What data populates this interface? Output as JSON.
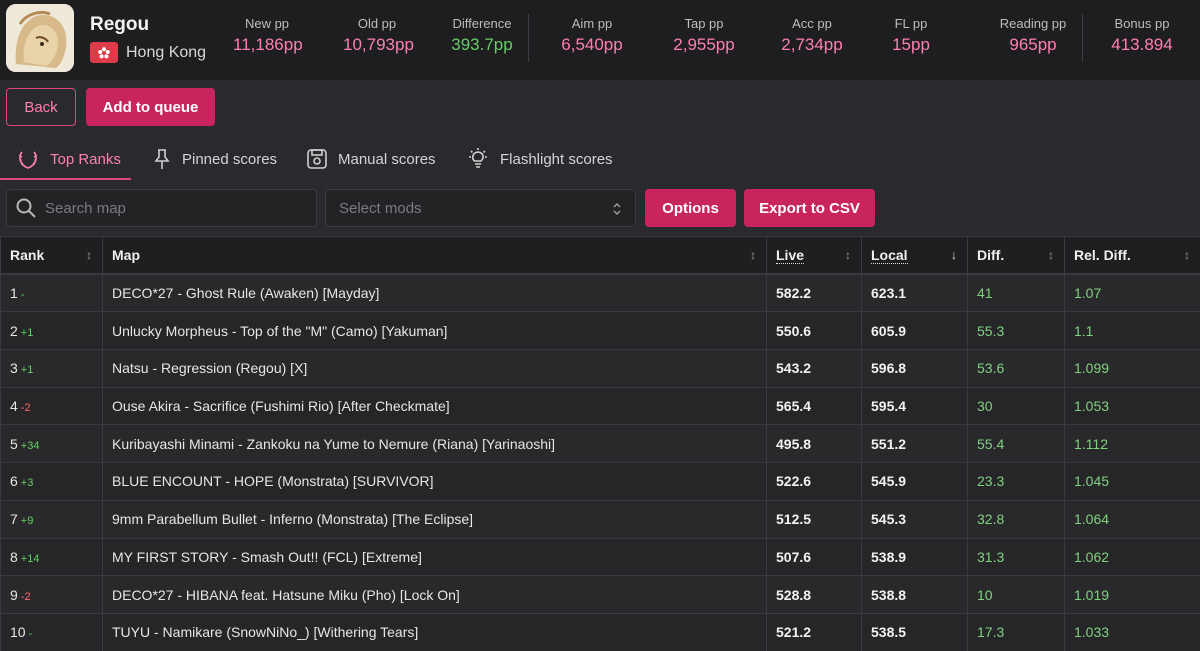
{
  "user": {
    "name": "Regou",
    "country": "Hong Kong"
  },
  "stats": [
    {
      "label": "New pp",
      "value": "11,186pp"
    },
    {
      "label": "Old pp",
      "value": "10,793pp"
    },
    {
      "label": "Difference",
      "value": "393.7pp"
    },
    {
      "label": "Aim pp",
      "value": "6,540pp"
    },
    {
      "label": "Tap pp",
      "value": "2,955pp"
    },
    {
      "label": "Acc pp",
      "value": "2,734pp"
    },
    {
      "label": "FL pp",
      "value": "15pp"
    },
    {
      "label": "Reading pp",
      "value": "965pp"
    },
    {
      "label": "Bonus pp",
      "value": "413.894"
    }
  ],
  "actions": {
    "back": "Back",
    "queue": "Add to queue"
  },
  "tabs": [
    {
      "label": "Top Ranks",
      "icon": "laurel-icon"
    },
    {
      "label": "Pinned scores",
      "icon": "pin-icon"
    },
    {
      "label": "Manual scores",
      "icon": "save-icon"
    },
    {
      "label": "Flashlight scores",
      "icon": "lightbulb-icon"
    }
  ],
  "filters": {
    "search_placeholder": "Search map",
    "mods_placeholder": "Select mods",
    "options": "Options",
    "export": "Export to CSV"
  },
  "columns": [
    "Rank",
    "Map",
    "Live",
    "Local",
    "Diff.",
    "Rel. Diff."
  ],
  "rows": [
    {
      "rank": "1",
      "change": "-",
      "map": "DECO*27 - Ghost Rule (Awaken) [Mayday]",
      "live": "582.2",
      "local": "623.1",
      "diff": "41",
      "rel": "1.07"
    },
    {
      "rank": "2",
      "change": "+1",
      "map": "Unlucky Morpheus - Top of the \"M\" (Camo) [Yakuman]",
      "live": "550.6",
      "local": "605.9",
      "diff": "55.3",
      "rel": "1.1"
    },
    {
      "rank": "3",
      "change": "+1",
      "map": "Natsu - Regression (Regou) [X]",
      "live": "543.2",
      "local": "596.8",
      "diff": "53.6",
      "rel": "1.099"
    },
    {
      "rank": "4",
      "change": "-2",
      "map": "Ouse Akira - Sacrifice (Fushimi Rio) [After Checkmate]",
      "live": "565.4",
      "local": "595.4",
      "diff": "30",
      "rel": "1.053"
    },
    {
      "rank": "5",
      "change": "+34",
      "map": "Kuribayashi Minami - Zankoku na Yume to Nemure (Riana) [Yarinaoshi]",
      "live": "495.8",
      "local": "551.2",
      "diff": "55.4",
      "rel": "1.112"
    },
    {
      "rank": "6",
      "change": "+3",
      "map": "BLUE ENCOUNT - HOPE (Monstrata) [SURVIVOR]",
      "live": "522.6",
      "local": "545.9",
      "diff": "23.3",
      "rel": "1.045"
    },
    {
      "rank": "7",
      "change": "+9",
      "map": "9mm Parabellum Bullet - Inferno (Monstrata) [The Eclipse]",
      "live": "512.5",
      "local": "545.3",
      "diff": "32.8",
      "rel": "1.064"
    },
    {
      "rank": "8",
      "change": "+14",
      "map": "MY FIRST STORY - Smash Out!! (FCL) [Extreme]",
      "live": "507.6",
      "local": "538.9",
      "diff": "31.3",
      "rel": "1.062"
    },
    {
      "rank": "9",
      "change": "-2",
      "map": "DECO*27 - HIBANA feat. Hatsune Miku (Pho) [Lock On]",
      "live": "528.8",
      "local": "538.8",
      "diff": "10",
      "rel": "1.019"
    },
    {
      "rank": "10",
      "change": "-",
      "map": "TUYU - Namikare (SnowNiNo_) [Withering Tears]",
      "live": "521.2",
      "local": "538.5",
      "diff": "17.3",
      "rel": "1.033"
    }
  ],
  "colors": {
    "accent": "#c8255f",
    "accent_text": "#ff7fb0",
    "positive": "#66cc66",
    "negative": "#ff6868",
    "background": "#2a2a2e"
  }
}
